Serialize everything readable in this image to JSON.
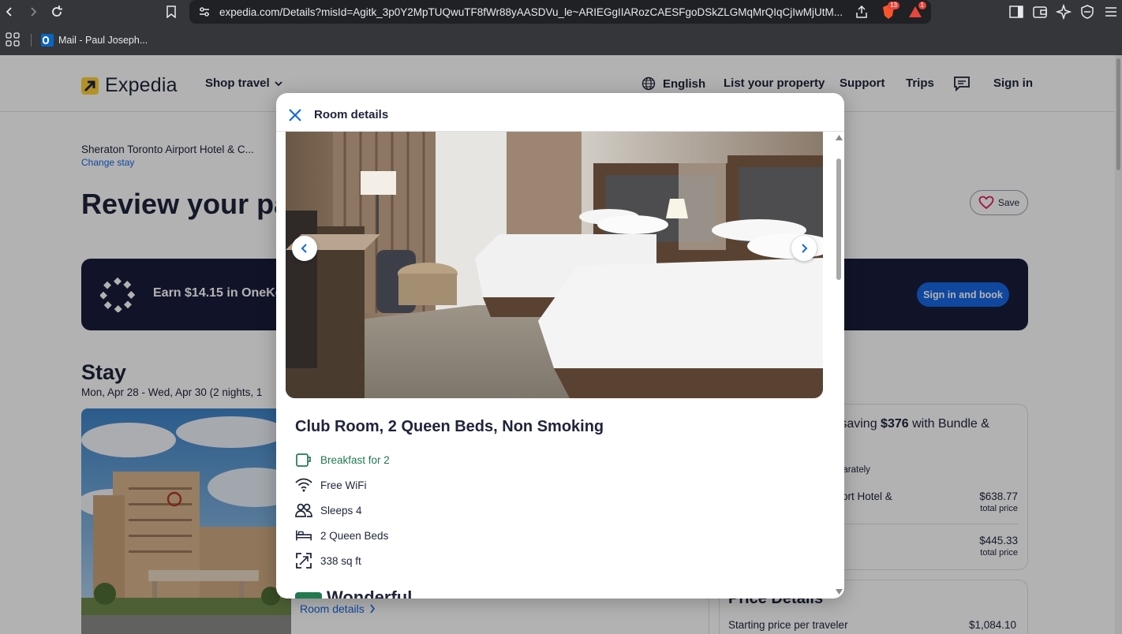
{
  "browser": {
    "url": "expedia.com/Details?misId=Agitk_3p0Y2MpTUQwuTF8fWr88yAASDVu_le~ARIEGgIIARozCAESFgoDSkZLGMqMrQIqCjIwMjUtM...",
    "bookmark": "Mail - Paul Joseph...",
    "brave_count": "13",
    "alert_count": "1"
  },
  "header": {
    "logo": "Expedia",
    "shop_travel": "Shop travel",
    "language": "English",
    "list_property": "List your property",
    "support": "Support",
    "trips": "Trips",
    "sign_in": "Sign in"
  },
  "page": {
    "hotel_name": "Sheraton Toronto Airport Hotel & C...",
    "change_stay": "Change stay",
    "review_title": "Review your pa",
    "save_label": "Save",
    "onekey_text": "Earn $14.15 in OneKey",
    "onekey_button": "Sign in and book",
    "stay_title": "Stay",
    "stay_dates": "Mon, Apr 28 - Wed, Apr 30 (2 nights, 1",
    "room_details_link": "Room details",
    "bundle_prefix": "e saving ",
    "bundle_amount": "$376",
    "bundle_suffix": " with Bundle &",
    "separately": "parately",
    "item1_name": "irport Hotel &",
    "item1_price": "$638.77",
    "item1_sub": "total price",
    "item2_price": "$445.33",
    "item2_sub": "total price",
    "price_details_title": "Price Details",
    "starting_price_label": "Starting price per traveler",
    "starting_price_value": "$1,084.10"
  },
  "modal": {
    "title": "Room details",
    "room_title": "Club Room, 2 Queen Beds, Non Smoking",
    "amenities": [
      {
        "label": "Breakfast for 2",
        "icon": "coffee-cup-icon"
      },
      {
        "label": "Free WiFi",
        "icon": "wifi-icon"
      },
      {
        "label": "Sleeps 4",
        "icon": "people-icon"
      },
      {
        "label": "2 Queen Beds",
        "icon": "bed-icon"
      },
      {
        "label": "338 sq ft",
        "icon": "expand-icon"
      }
    ],
    "rating_word": "Wonderful"
  },
  "colors": {
    "brand_blue": "#1668e3",
    "navy": "#191e3b",
    "green": "#227950",
    "logo_yellow": "#ffd138"
  }
}
